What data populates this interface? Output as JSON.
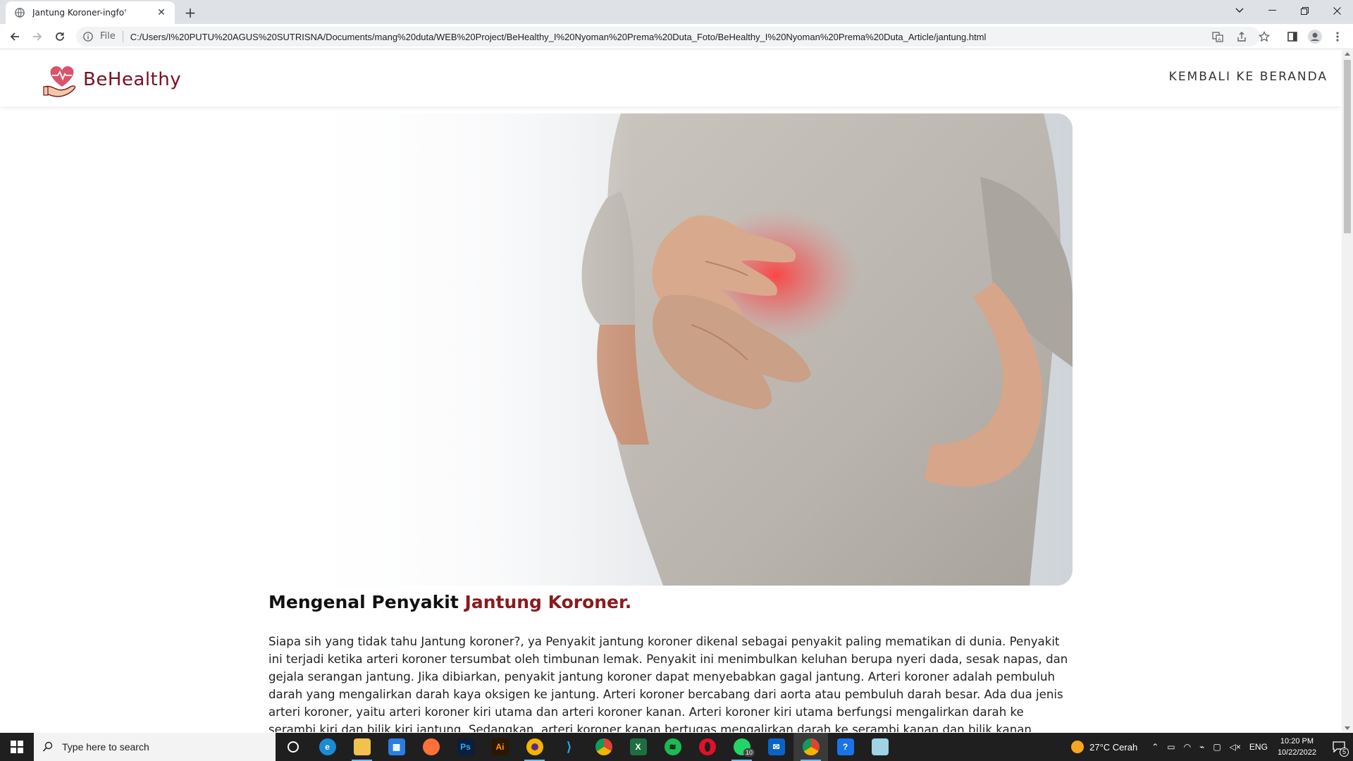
{
  "browser": {
    "tab_title": "Jantung Koroner-ingfo'",
    "url_scheme": "File",
    "url": "C:/Users/I%20PUTU%20AGUS%20SUTRISNA/Documents/mang%20duta/WEB%20Project/BeHealthy_I%20Nyoman%20Prema%20Duta_Foto/BeHealthy_I%20Nyoman%20Prema%20Duta_Article/jantung.html"
  },
  "site": {
    "brand": "BeHealthy",
    "nav_back": "KEMBALI KE BERANDA",
    "accent_color": "#8b1a1f"
  },
  "article": {
    "title_prefix": "Mengenal Penyakit",
    "title_accent": "Jantung Koroner.",
    "body": "Siapa sih yang tidak tahu Jantung koroner?, ya Penyakit jantung koroner dikenal sebagai penyakit paling mematikan di dunia. Penyakit ini terjadi ketika arteri koroner tersumbat oleh timbunan lemak. Penyakit ini menimbulkan keluhan berupa nyeri dada, sesak napas, dan gejala serangan jantung. Jika dibiarkan, penyakit jantung koroner dapat menyebabkan gagal jantung. Arteri koroner adalah pembuluh darah yang mengalirkan darah kaya oksigen ke jantung. Arteri koroner bercabang dari aorta atau pembuluh darah besar. Ada dua jenis arteri koroner, yaitu arteri koroner kiri utama dan arteri koroner kanan. Arteri koroner kiri utama berfungsi mengalirkan darah ke serambi kiri dan bilik kiri jantung. Sedangkan, arteri koroner kanan bertugas mengalirkan darah ke serambi kanan dan bilik kanan jantung. Penumpukan lemak pada"
  },
  "taskbar": {
    "search_placeholder": "Type here to search",
    "whatsapp_badge": "10",
    "weather": "27°C  Cerah",
    "lang": "ENG",
    "time": "10:20 PM",
    "date": "10/22/2022",
    "notif_count": "5"
  }
}
